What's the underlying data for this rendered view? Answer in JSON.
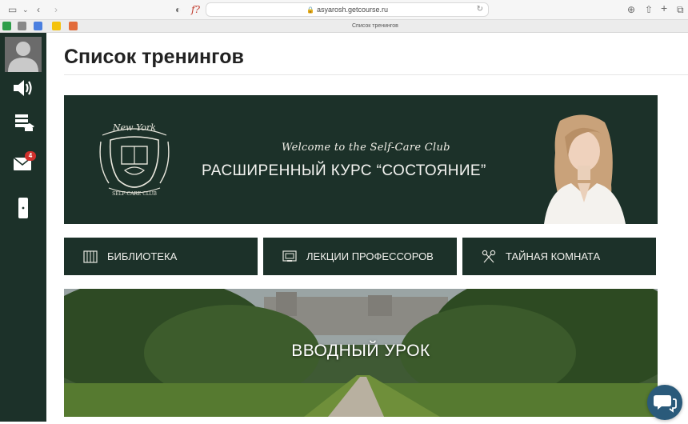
{
  "browser": {
    "url": "asyarosh.getcourse.ru",
    "tab_title": "Список тренингов"
  },
  "sidebar": {
    "notifications_badge": "4",
    "icons": [
      "avatar-icon",
      "speaker-icon",
      "graduation-cap-icon",
      "mail-icon",
      "phone-icon"
    ]
  },
  "page": {
    "title": "Список тренингов"
  },
  "hero": {
    "welcome": "Welcome to the Self-Care Club",
    "course_title": "РАСШИРЕННЫЙ КУРС “СОСТОЯНИЕ”",
    "emblem_top": "New York",
    "emblem_bottom": "SELF-CARE CLUB"
  },
  "nav_buttons": [
    {
      "label": "БИБЛИОТЕКА",
      "icon": "library-icon"
    },
    {
      "label": "ЛЕКЦИИ ПРОФЕССОРОВ",
      "icon": "lecture-icon"
    },
    {
      "label": "ТАЙНАЯ КОМНАТА",
      "icon": "keys-icon"
    }
  ],
  "lesson": {
    "title": "ВВОДНЫЙ УРОК"
  },
  "colors": {
    "brand_dark_green": "#1c3129",
    "badge_red": "#d0312d",
    "chat_blue": "#2a5a7a"
  }
}
